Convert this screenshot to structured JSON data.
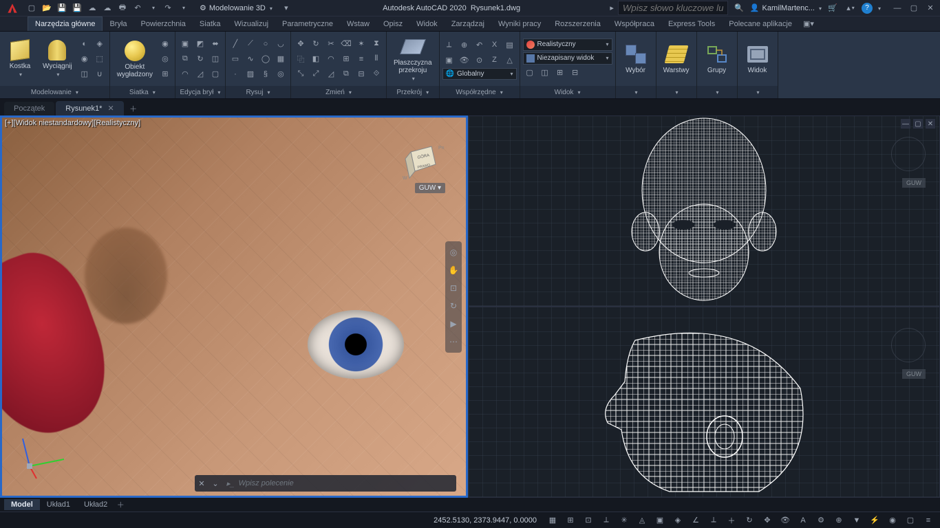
{
  "app": {
    "title_product": "Autodesk AutoCAD 2020",
    "title_file": "Rysunek1.dwg",
    "workspace": "Modelowanie 3D",
    "search_placeholder": "Wpisz słowo kluczowe lub frazę",
    "user": "KamilMartenc..."
  },
  "ribbon_tabs": [
    "Narzędzia główne",
    "Bryła",
    "Powierzchnia",
    "Siatka",
    "Wizualizuj",
    "Parametryczne",
    "Wstaw",
    "Opisz",
    "Widok",
    "Zarządzaj",
    "Wyniki pracy",
    "Rozszerzenia",
    "Współpraca",
    "Express Tools",
    "Polecane aplikacje"
  ],
  "ribbon_active": 0,
  "panels": {
    "model": {
      "title": "Modelowanie",
      "btn1": "Kostka",
      "btn2": "Wyciągnij"
    },
    "mesh": {
      "title": "Siatka",
      "btn": "Obiekt\nwygładzony"
    },
    "solidedit": {
      "title": "Edycja brył"
    },
    "draw": {
      "title": "Rysuj"
    },
    "modify": {
      "title": "Zmień"
    },
    "section": {
      "title": "Przekrój",
      "btn": "Płaszczyzna\nprzekroju"
    },
    "coords": {
      "title": "Współrzędne",
      "world": "Globalny"
    },
    "view": {
      "title": "Widok",
      "style": "Realistyczny",
      "saved": "Niezapisany widok"
    },
    "sel": {
      "title": "",
      "btn": "Wybór"
    },
    "layers": {
      "title": "",
      "btn": "Warstwy"
    },
    "groups": {
      "title": "",
      "btn": "Grupy"
    },
    "viewp": {
      "title": "",
      "btn": "Widok"
    }
  },
  "file_tabs": {
    "start": "Początek",
    "drawing": "Rysunek1*"
  },
  "viewport": {
    "label_nonstd": "[+][Widok niestandardowy][Realistyczny]",
    "cube_top": "GÓRA",
    "cube_right": "PRAWO",
    "compass_n": "Pn",
    "compass_w": "W",
    "guw": "GUW"
  },
  "command": {
    "placeholder": "Wpisz polecenie"
  },
  "model_tabs": [
    "Model",
    "Układ1",
    "Układ2"
  ],
  "status": {
    "coords": "2452.5130, 2373.9447, 0.0000"
  }
}
